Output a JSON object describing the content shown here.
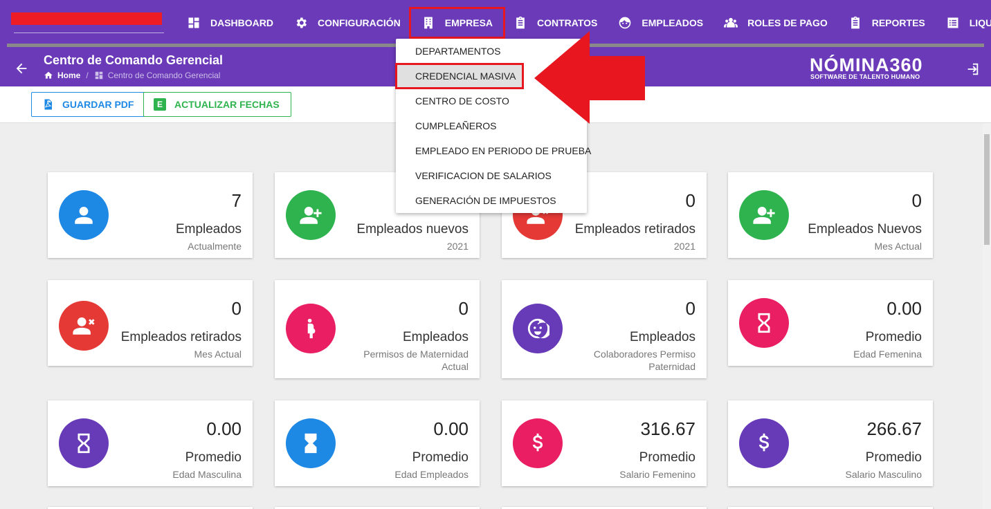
{
  "nav": {
    "items": [
      {
        "label": "DASHBOARD",
        "icon": "dashboard-icon"
      },
      {
        "label": "CONFIGURACIÓN",
        "icon": "gear-icon"
      },
      {
        "label": "EMPRESA",
        "icon": "building-icon",
        "active": true
      },
      {
        "label": "CONTRATOS",
        "icon": "clipboard-icon"
      },
      {
        "label": "EMPLEADOS",
        "icon": "face-icon"
      },
      {
        "label": "ROLES DE PAGO",
        "icon": "group-icon"
      },
      {
        "label": "REPORTES",
        "icon": "clipboard-list-icon"
      },
      {
        "label": "LIQUIDACIONE",
        "icon": "list-icon"
      }
    ]
  },
  "header": {
    "title": "Centro de Comando Gerencial",
    "breadcrumb_home": "Home",
    "breadcrumb_separator": "/",
    "breadcrumb_current": "Centro de Comando Gerencial",
    "logo": "NÓMINA360",
    "logo_tagline": "SOFTWARE DE TALENTO HUMANO"
  },
  "actions": {
    "pdf_label": "GUARDAR PDF",
    "update_label": "ACTUALIZAR FECHAS",
    "excel_letter": "E"
  },
  "dropdown": {
    "items": [
      "DEPARTAMENTOS",
      "CREDENCIAL MASIVA",
      "CENTRO DE COSTO",
      "CUMPLEAÑEROS",
      "EMPLEADO EN PERIODO DE PRUEBA",
      "VERIFICACION DE SALARIOS",
      "GENERACIÓN DE IMPUESTOS"
    ],
    "highlighted": "CREDENCIAL MASIVA"
  },
  "cards": [
    {
      "value": "7",
      "title": "Empleados",
      "subtitle": "Actualmente",
      "icon": "user-icon",
      "color": "#1e88e5"
    },
    {
      "value": "",
      "title": "Empleados nuevos",
      "subtitle": "2021",
      "icon": "user-plus-icon",
      "color": "#2eb34e"
    },
    {
      "value": "0",
      "title": "Empleados retirados",
      "subtitle": "2021",
      "icon": "user-remove-icon",
      "color": "#e53935"
    },
    {
      "value": "0",
      "title": "Empleados Nuevos",
      "subtitle": "Mes Actual",
      "icon": "user-plus-icon",
      "color": "#2eb34e"
    },
    {
      "value": "0",
      "title": "Empleados retirados",
      "subtitle": "Mes Actual",
      "icon": "user-remove-icon",
      "color": "#e53935"
    },
    {
      "value": "0",
      "title": "Empleados",
      "subtitle": "Permisos de Maternidad Actual",
      "icon": "pregnant-icon",
      "color": "#e91e63"
    },
    {
      "value": "0",
      "title": "Empleados",
      "subtitle": "Colaboradores Permiso Paternidad",
      "icon": "baby-face-icon",
      "color": "#673ab7"
    },
    {
      "value": "0.00",
      "title": "Promedio",
      "subtitle": "Edad Femenina",
      "icon": "hourglass-icon",
      "color": "#e91e63"
    },
    {
      "value": "0.00",
      "title": "Promedio",
      "subtitle": "Edad Masculina",
      "icon": "hourglass-icon",
      "color": "#673ab7"
    },
    {
      "value": "0.00",
      "title": "Promedio",
      "subtitle": "Edad Empleados",
      "icon": "hourglass-full-icon",
      "color": "#1e88e5"
    },
    {
      "value": "316.67",
      "title": "Promedio",
      "subtitle": "Salario Femenino",
      "icon": "dollar-icon",
      "color": "#e91e63"
    },
    {
      "value": "266.67",
      "title": "Promedio",
      "subtitle": "Salario Masculino",
      "icon": "dollar-icon",
      "color": "#673ab7"
    }
  ],
  "colors": {
    "primary": "#6a3ab8",
    "annotation_red": "#e8161f",
    "pdf_blue": "#1e88e5",
    "excel_green": "#2eb34e"
  }
}
